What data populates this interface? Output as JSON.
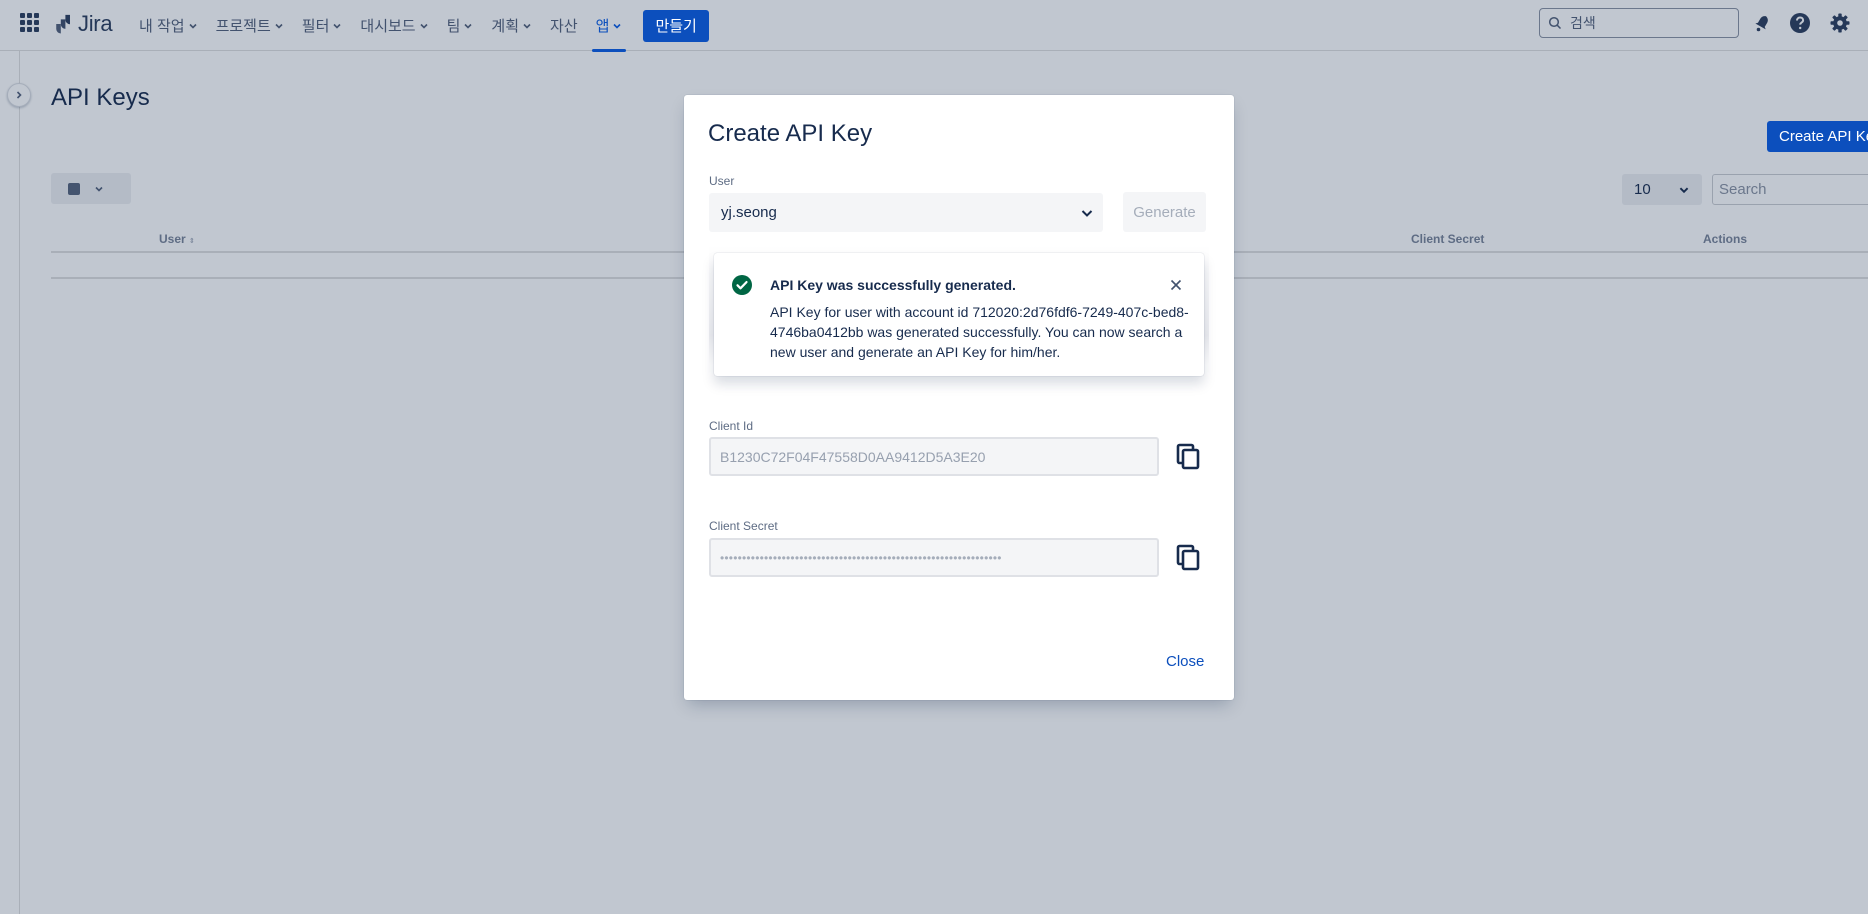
{
  "topnav": {
    "app_switcher_icon": "grid-icon",
    "logo": "Jira",
    "items": [
      {
        "label": "내 작업",
        "has_dropdown": true
      },
      {
        "label": "프로젝트",
        "has_dropdown": true
      },
      {
        "label": "필터",
        "has_dropdown": true
      },
      {
        "label": "대시보드",
        "has_dropdown": true
      },
      {
        "label": "팀",
        "has_dropdown": true
      },
      {
        "label": "계획",
        "has_dropdown": true
      },
      {
        "label": "자산",
        "has_dropdown": false
      },
      {
        "label": "앱",
        "has_dropdown": true,
        "active": true
      }
    ],
    "create_label": "만들기",
    "search_placeholder": "검색",
    "icons": [
      "notification-icon",
      "help-icon",
      "settings-icon"
    ]
  },
  "page": {
    "title": "API Keys",
    "create_button": "Create API Key",
    "page_size": "10",
    "search_placeholder": "Search",
    "columns": [
      "User",
      "Client Secret",
      "Actions"
    ]
  },
  "modal": {
    "title": "Create API Key",
    "user_label": "User",
    "user_value": "yj.seong",
    "generate_label": "Generate",
    "flag": {
      "title": "API Key was successfully generated.",
      "description": "API Key for user with account id 712020:2d76fdf6-7249-407c-bed8-4746ba0412bb was generated successfully. You can now search a new user and generate an API Key for him/her."
    },
    "client_id_label": "Client Id",
    "client_id_value": "B1230C72F04F47558D0AA9412D5A3E20",
    "client_secret_label": "Client Secret",
    "client_secret_value": "••••••••••••••••••••••••••••••••••••••••••••••••••••••••••••••••",
    "close_label": "Close"
  },
  "colors": {
    "brand_blue": "#0c4fbd",
    "success_green": "#006644",
    "overlay": "#c1c7d0"
  }
}
